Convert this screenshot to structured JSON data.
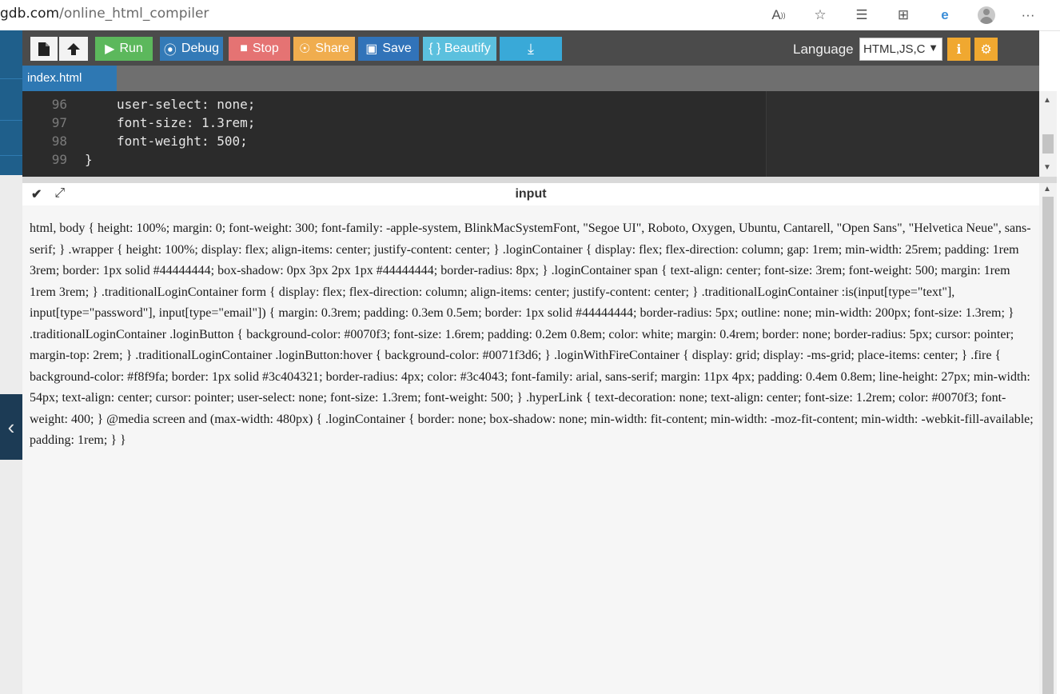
{
  "browser": {
    "url_host": "gdb.com",
    "url_path": "/online_html_compiler",
    "icons": [
      "read-aloud-icon",
      "favorite-add-icon",
      "favorites-icon",
      "collections-icon",
      "edge-extension-icon",
      "profile-icon",
      "more-icon"
    ]
  },
  "toolbar": {
    "run_label": "Run",
    "debug_label": "Debug",
    "stop_label": "Stop",
    "share_label": "Share",
    "save_label": "Save",
    "beautify_label": "{ } Beautify",
    "language_label": "Language",
    "language_value": "HTML,JS,C",
    "colors": {
      "run": "#5cb85c",
      "debug": "#337ab7",
      "stop": "#e57373",
      "share": "#f0ad4e",
      "save": "#3173b9",
      "beautify": "#5bc0de",
      "download": "#39a9d8",
      "orange": "#f0a830"
    }
  },
  "tab": {
    "name": "index.html"
  },
  "editor": {
    "lines": [
      {
        "num": "96",
        "text": "user-select: none;"
      },
      {
        "num": "97",
        "text": "font-size: 1.3rem;"
      },
      {
        "num": "98",
        "text": "font-weight: 500;"
      },
      {
        "num": "99",
        "text": "}"
      }
    ]
  },
  "io": {
    "title": "input",
    "content": "html, body { height: 100%; margin: 0; font-weight: 300; font-family: -apple-system, BlinkMacSystemFont, \"Segoe UI\", Roboto, Oxygen, Ubuntu, Cantarell, \"Open Sans\", \"Helvetica Neue\", sans-serif; } .wrapper { height: 100%; display: flex; align-items: center; justify-content: center; } .loginContainer { display: flex; flex-direction: column; gap: 1rem; min-width: 25rem; padding: 1rem 3rem; border: 1px solid #44444444; box-shadow: 0px 3px 2px 1px #44444444; border-radius: 8px; } .loginContainer span { text-align: center; font-size: 3rem; font-weight: 500; margin: 1rem 1rem 3rem; } .traditionalLoginContainer form { display: flex; flex-direction: column; align-items: center; justify-content: center; } .traditionalLoginContainer :is(input[type=\"text\"], input[type=\"password\"], input[type=\"email\"]) { margin: 0.3rem; padding: 0.3em 0.5em; border: 1px solid #44444444; border-radius: 5px; outline: none; min-width: 200px; font-size: 1.3rem; } .traditionalLoginContainer .loginButton { background-color: #0070f3; font-size: 1.6rem; padding: 0.2em 0.8em; color: white; margin: 0.4rem; border: none; border-radius: 5px; cursor: pointer; margin-top: 2rem; } .traditionalLoginContainer .loginButton:hover { background-color: #0071f3d6; } .loginWithFireContainer { display: grid; display: -ms-grid; place-items: center; } .fire { background-color: #f8f9fa; border: 1px solid #3c404321; border-radius: 4px; color: #3c4043; font-family: arial, sans-serif; margin: 11px 4px; padding: 0.4em 0.8em; line-height: 27px; min-width: 54px; text-align: center; cursor: pointer; user-select: none; font-size: 1.3rem; font-weight: 500; } .hyperLink { text-decoration: none; text-align: center; font-size: 1.2rem; color: #0070f3; font-weight: 400; } @media screen and (max-width: 480px) { .loginContainer { border: none; box-shadow: none; min-width: fit-content; min-width: -moz-fit-content; min-width: -webkit-fill-available; padding: 1rem; } }"
  }
}
